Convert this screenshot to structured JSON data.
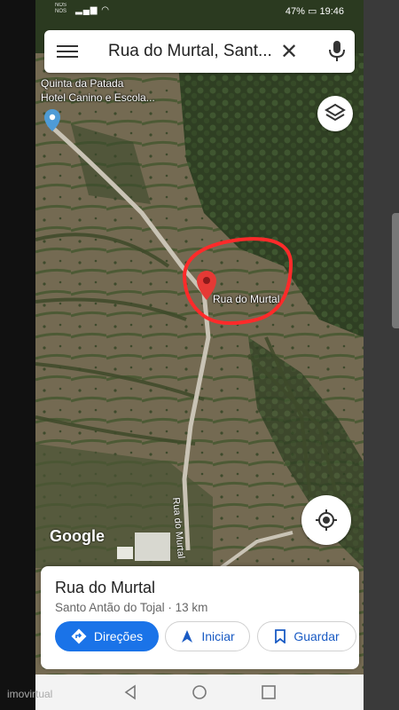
{
  "status": {
    "carrier_lines": [
      "NOS",
      "NOS"
    ],
    "battery": "47%",
    "time": "19:46"
  },
  "search": {
    "query": "Rua do Murtal, Sant..."
  },
  "map": {
    "poi_line1": "Quinta da Patada",
    "poi_line2": "Hotel Canino e Escola...",
    "marker_label": "Rua do Murtal",
    "road_label": "Rua do Murtal",
    "logo": "Google"
  },
  "card": {
    "title": "Rua do Murtal",
    "subtitle": "Santo Antão do Tojal · 13 km",
    "directions_label": "Direções",
    "start_label": "Iniciar",
    "save_label": "Guardar"
  },
  "watermark": "imovirtual",
  "colors": {
    "accent": "#1a73e8",
    "marker": "#e53935",
    "circle": "#ff2a2a"
  },
  "icons": [
    "menu-icon",
    "close-icon",
    "mic-icon",
    "layers-icon",
    "my-location-icon",
    "directions-icon",
    "navigation-icon",
    "bookmark-icon",
    "back-icon",
    "home-icon",
    "recents-icon",
    "pin-icon"
  ]
}
